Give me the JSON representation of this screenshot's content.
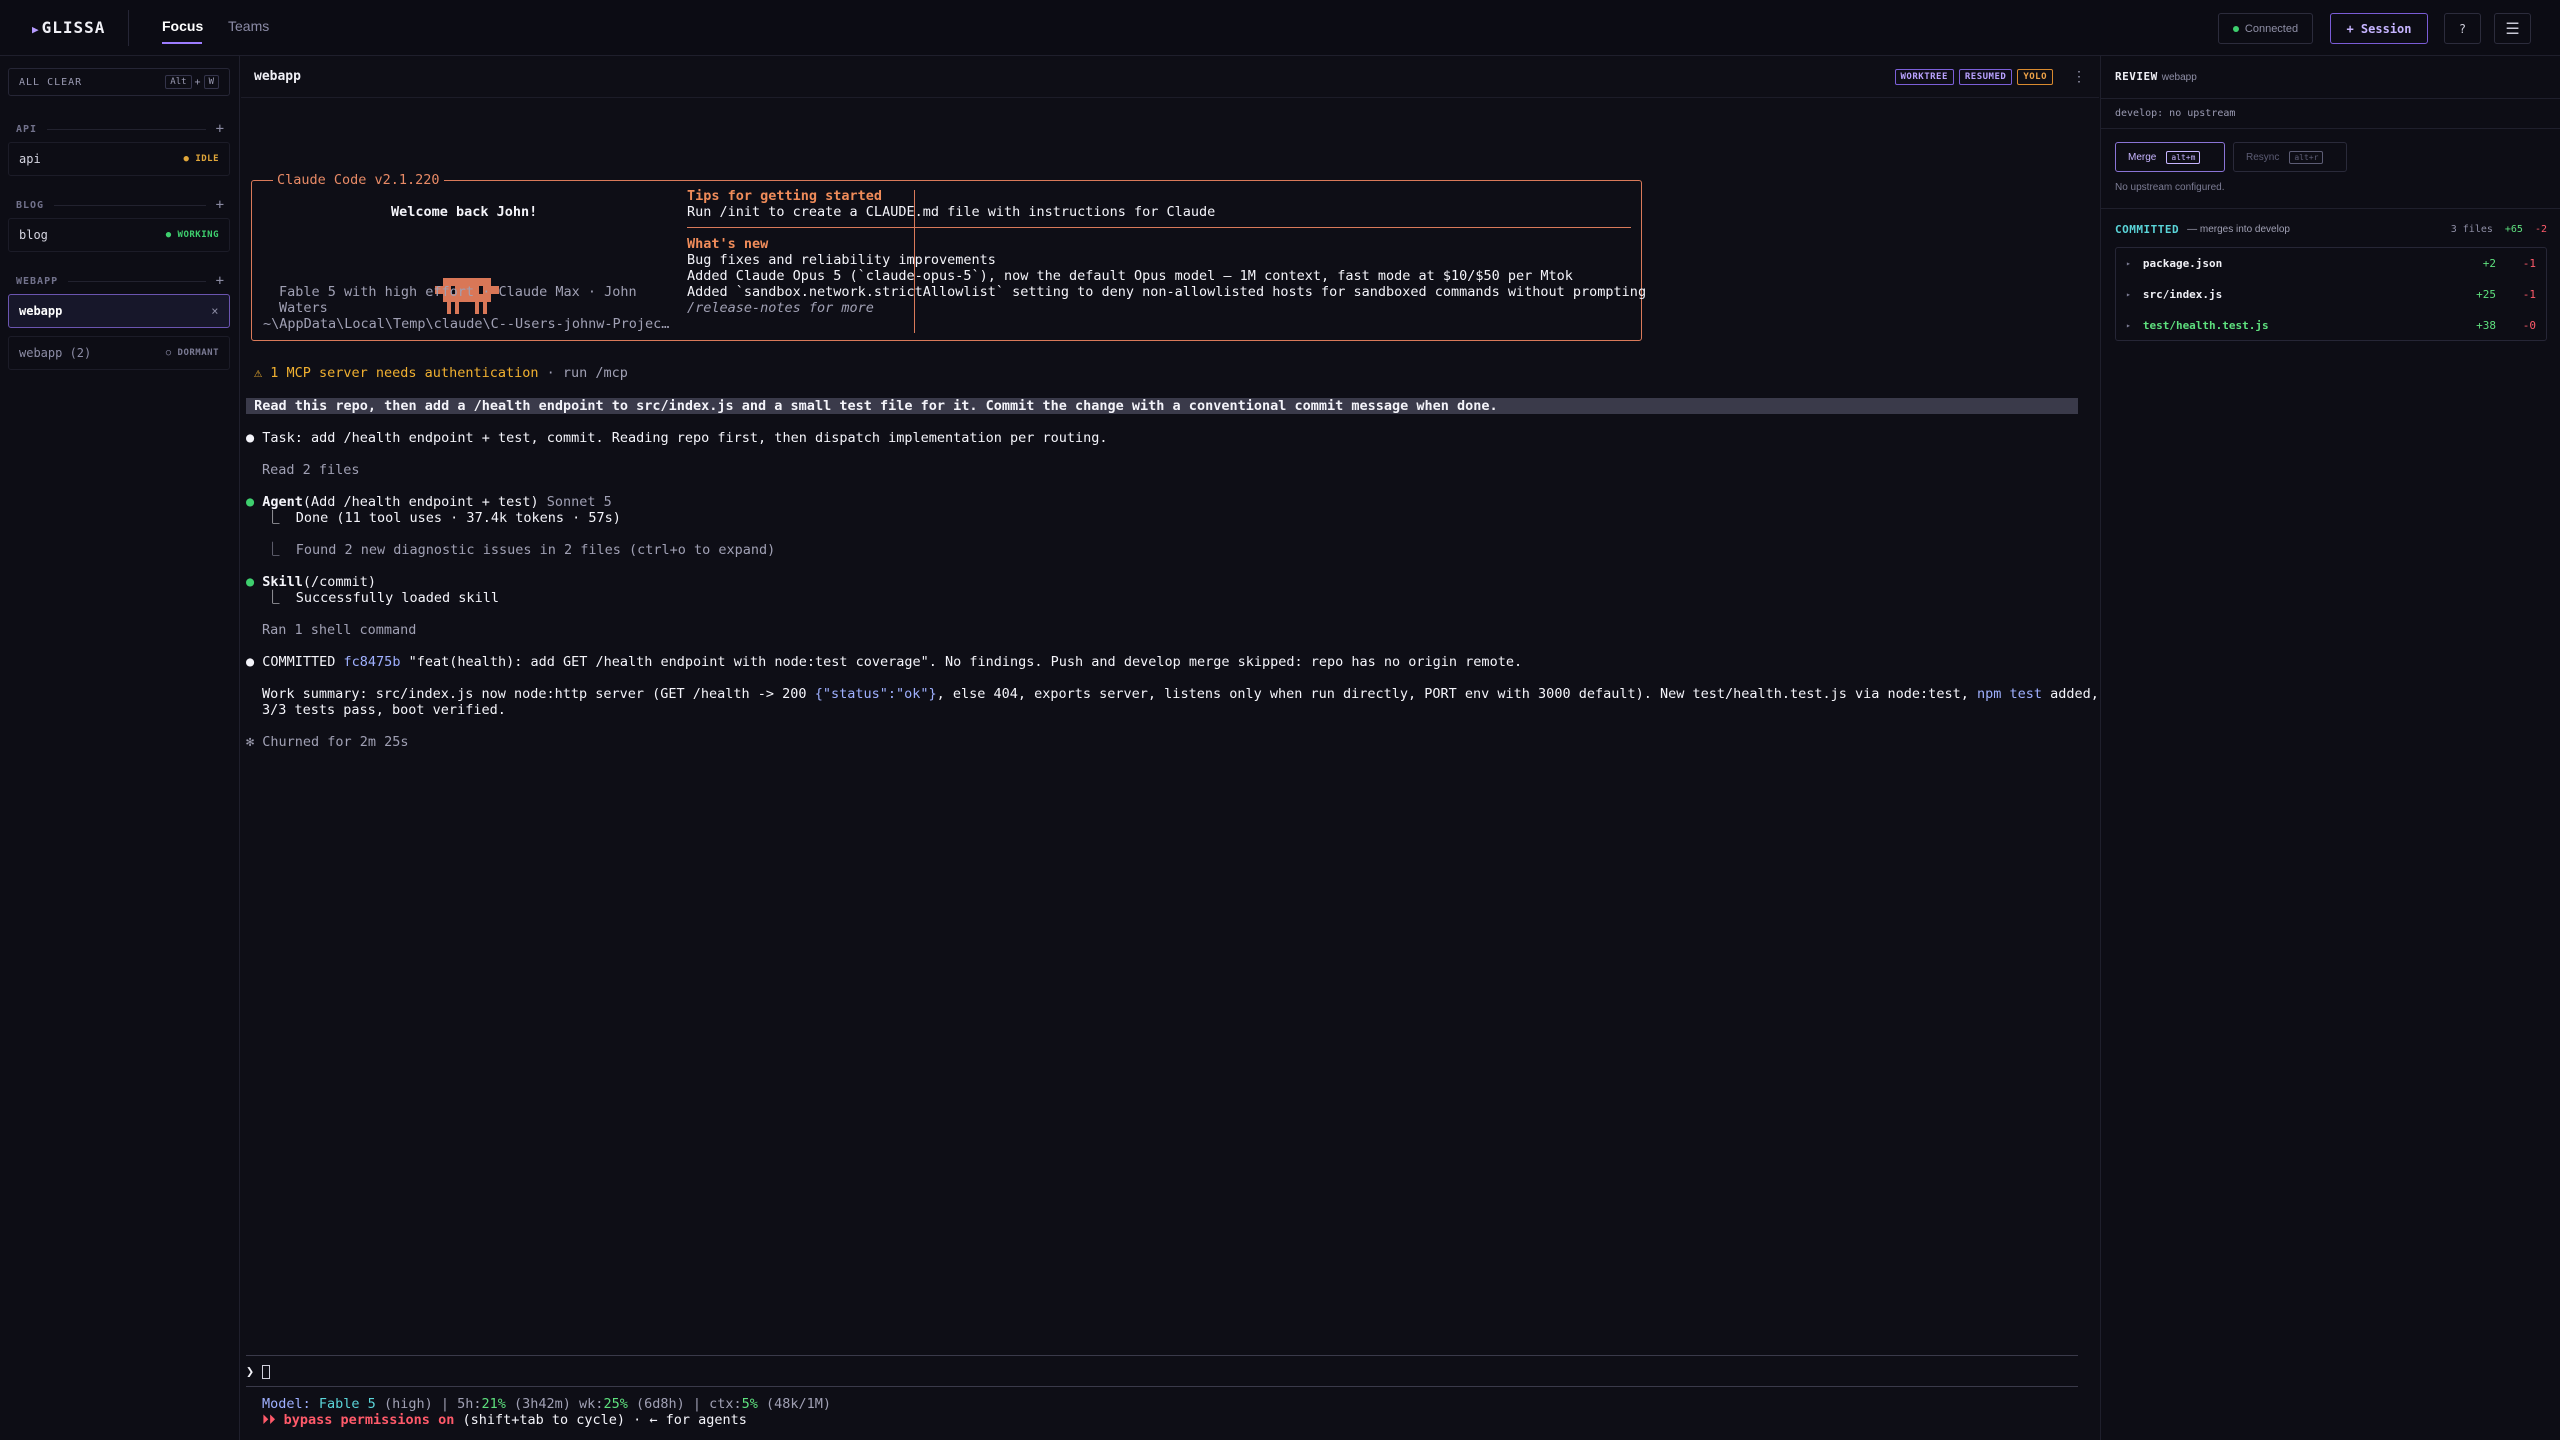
{
  "app": {
    "logo": "GLISSA",
    "tabs": [
      "Focus",
      "Teams"
    ]
  },
  "topbar": {
    "connection": "Connected",
    "session_button": "+ Session",
    "help": "?",
    "menu": "☰"
  },
  "colors": {
    "accent": "#9d7cff",
    "working": "#3ecf6e",
    "idle": "#e0a63a",
    "claude_orange": "#e88a66",
    "committed": "#5ad4d8",
    "added": "#5ee07e",
    "removed": "#ff5a6a"
  },
  "sidebar": {
    "all_clear": {
      "label": "ALL CLEAR",
      "keys": [
        "Alt",
        "+",
        "W"
      ]
    },
    "groups": [
      {
        "name": "API",
        "items": [
          {
            "label": "api",
            "status": "● IDLE"
          }
        ]
      },
      {
        "name": "BLOG",
        "items": [
          {
            "label": "blog",
            "status": "● WORKING"
          }
        ]
      },
      {
        "name": "WEBAPP",
        "items": [
          {
            "label": "webapp",
            "status": "×"
          },
          {
            "label": "webapp (2)",
            "status": "○ DORMANT"
          }
        ]
      }
    ]
  },
  "session": {
    "title": "webapp",
    "badges": [
      "WORKTREE",
      "RESUMED",
      "YOLO"
    ],
    "welcome": {
      "title": "Claude Code v2.1.220",
      "greeting": "Welcome back John!",
      "model_line1": "Fable 5 with high effort · Claude Max · John",
      "model_line2": "Waters",
      "path": "~\\AppData\\Local\\Temp\\claude\\C--Users-johnw-Projec…",
      "tips_title": "Tips for getting started",
      "tips_line": "Run /init to create a CLAUDE.md file with instructions for Claude",
      "whats_new_title": "What's new",
      "news": [
        "Bug fixes and reliability improvements",
        "Added Claude Opus 5 (`claude-opus-5`), now the default Opus model — 1M context, fast mode at $10/$50 per Mtok",
        "Added `sandbox.network.strictAllowlist` setting to deny non-allowlisted hosts for sandboxed commands without prompting"
      ],
      "release_notes": "/release-notes for more"
    },
    "mcp_warning": {
      "text": "⚠ 1 MCP server needs authentication",
      "hint": " · run /mcp"
    },
    "prompt": " Read this repo, then add a /health endpoint to src/index.js and a small test file for it. Commit the change with a conventional commit message when done. ",
    "task": "Task: add /health endpoint + test, commit. Reading repo first, then dispatch implementation per routing.",
    "read_files": "Read 2 files",
    "agent": {
      "name": "Agent",
      "arg": "(Add /health endpoint + test)",
      "model": " Sonnet 5",
      "result": "⎿  Done (11 tool uses · 37.4k tokens · 57s)"
    },
    "diagnostics": "⎿  Found 2 new diagnostic issues in 2 files (ctrl+o to expand)",
    "skill": {
      "name": "Skill",
      "arg": "(/commit)",
      "result": "⎿  Successfully loaded skill"
    },
    "shell": "Ran 1 shell command",
    "commit": {
      "label": "COMMITTED ",
      "hash": "fc8475b",
      "message": " \"feat(health): add GET /health endpoint with node:test coverage\". No findings. Push and develop merge skipped: repo has no origin remote."
    },
    "summary": {
      "line1a": "Work summary: src/index.js now node:http server (GET /health -> 200 ",
      "json_literal": "{\"status\":\"ok\"}",
      "line1b": ", else 404, exports server, listens only when run directly, PORT env with 3000 default). New test/health.test.js via node:test, ",
      "npm": "npm test",
      "line1c": " added,",
      "line2": "3/3 tests pass, boot verified."
    },
    "churned": "✻ Churned for 2m 25s",
    "input_prompt": "❯ ",
    "status": {
      "model_label": "Model: ",
      "model": "Fable 5",
      "effort": " (high)",
      "s1": " | 5h:",
      "p5h": "21%",
      "t5h": " (3h42m)",
      "s2": " wk:",
      "pwk": "25%",
      "twk": " (6d8h)",
      "s3": " | ctx:",
      "pctx": "5%",
      "tctx": " (48k/1M)",
      "perm_icon": "⏵⏵ ",
      "perm": "bypass permissions on",
      "perm_hint": " (shift+tab to cycle) · ← for agents"
    }
  },
  "review": {
    "title": "REVIEW",
    "subject": "webapp",
    "upstream": "develop: no upstream",
    "merge_label": "Merge",
    "merge_key": "alt+m",
    "resync_label": "Resync",
    "resync_key": "alt+r",
    "no_upstream": "No upstream configured.",
    "committed_label": "COMMITTED",
    "merges_into": "— merges into develop",
    "files_count": "3 files",
    "total_add": "+65",
    "total_del": "-2",
    "files": [
      {
        "name": "package.json",
        "add": "+2",
        "del": "-1",
        "new": false
      },
      {
        "name": "src/index.js",
        "add": "+25",
        "del": "-1",
        "new": false
      },
      {
        "name": "test/health.test.js",
        "add": "+38",
        "del": "-0",
        "new": true
      }
    ]
  }
}
